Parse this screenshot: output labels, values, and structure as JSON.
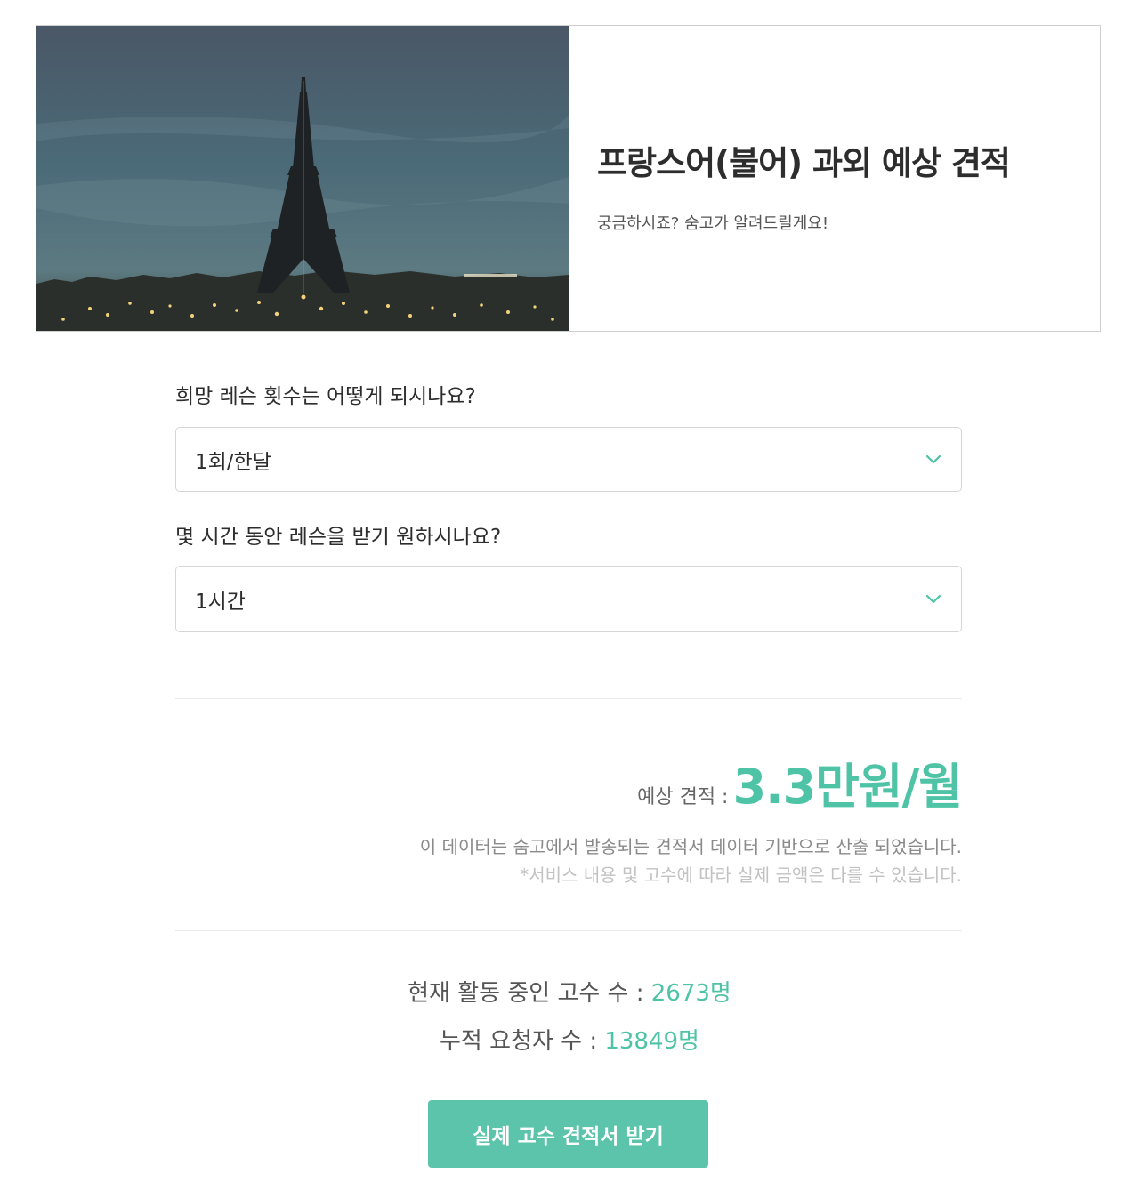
{
  "hero": {
    "title": "프랑스어(불어) 과외 예상 견적",
    "subtitle": "궁금하시죠? 숨고가 알려드릴게요!",
    "image": "eiffel-tower-at-dusk-photo"
  },
  "questions": [
    {
      "label": "희망 레슨 횟수는 어떻게 되시나요?",
      "selected": "1회/한달"
    },
    {
      "label": "몇 시간 동안 레슨을 받기 원하시나요?",
      "selected": "1시간"
    }
  ],
  "estimate": {
    "label": "예상 견적 :",
    "value": "3.3만원/월",
    "note": "이 데이터는 숨고에서 발송되는 견적서 데이터 기반으로 산출 되었습니다.",
    "disclaimer": "*서비스 내용 및 고수에 따라 실제 금액은 다를 수 있습니다."
  },
  "stats": {
    "active_label": "현재 활동 중인 고수 수 :",
    "active_value": "2673명",
    "requesters_label": "누적 요청자 수 :",
    "requesters_value": "13849명"
  },
  "cta": {
    "label": "실제 고수 견적서 받기"
  },
  "colors": {
    "accent": "#4ec3a6",
    "button": "#5cc4aa"
  },
  "icons": {
    "dropdown": "chevron-down-icon"
  }
}
